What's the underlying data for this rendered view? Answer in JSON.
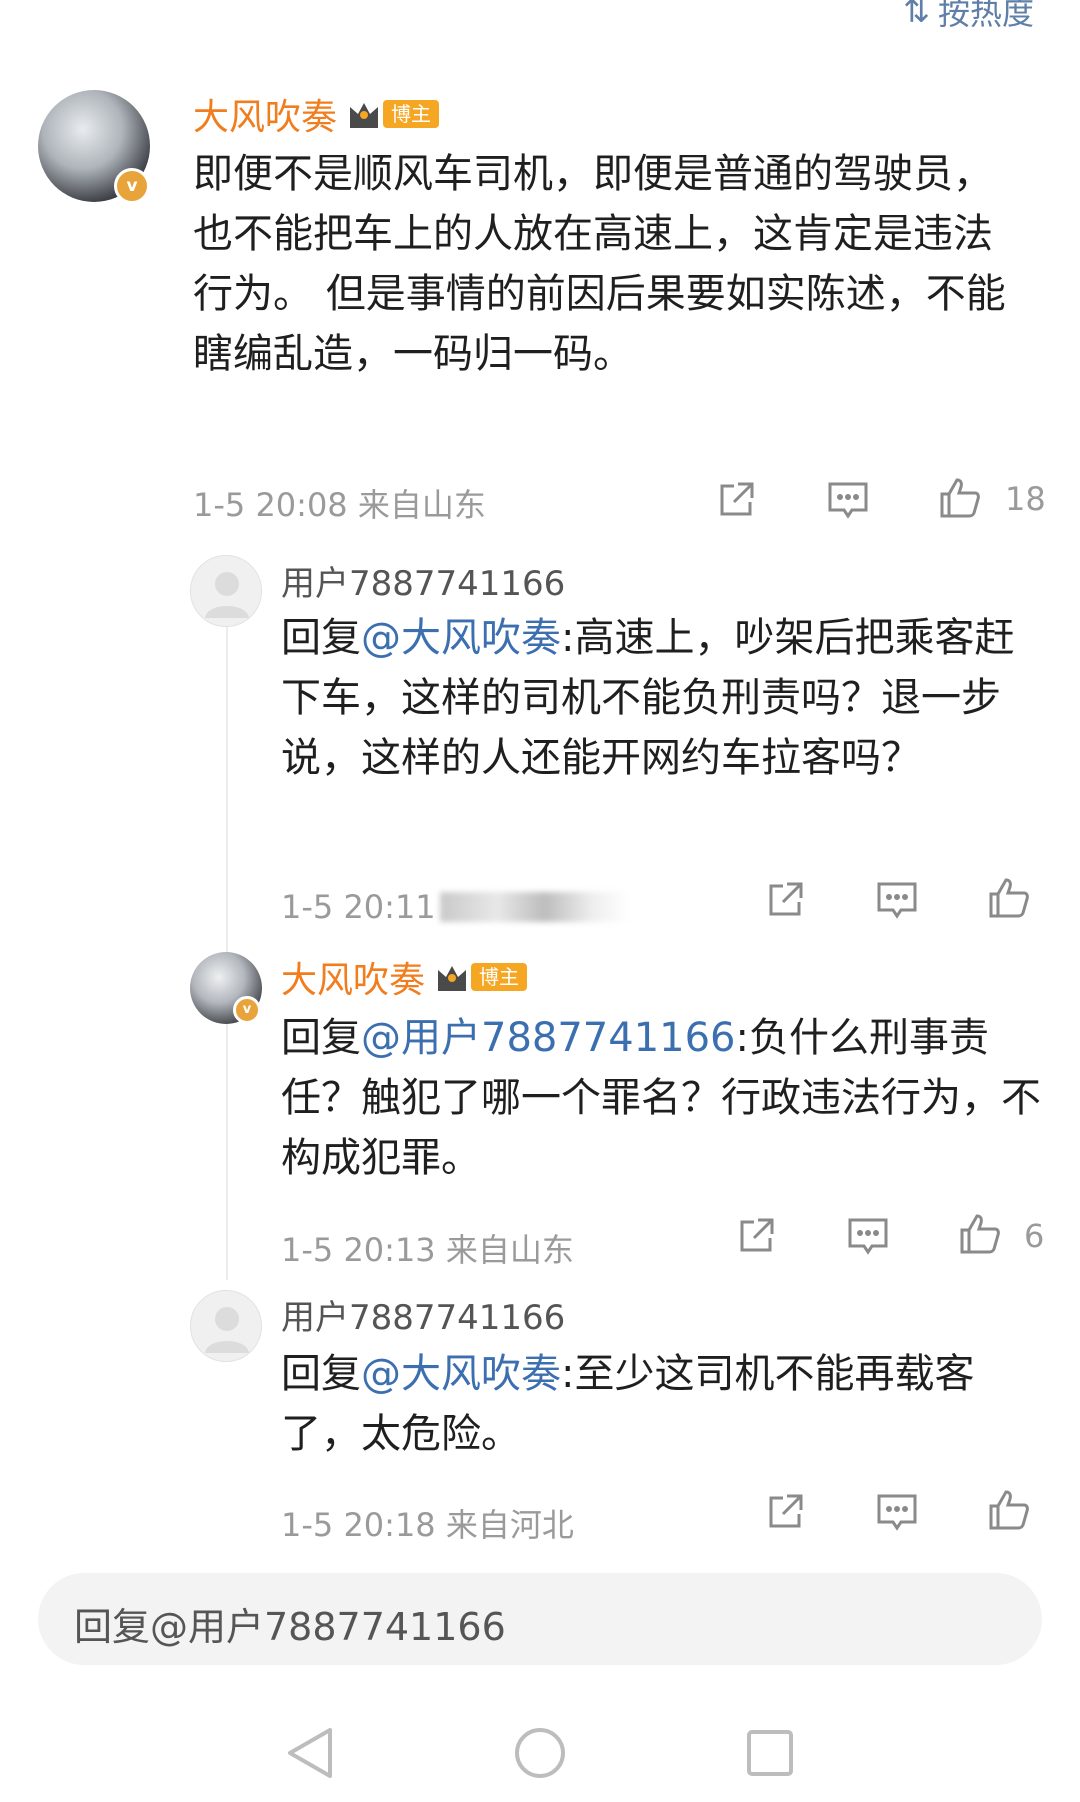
{
  "sort": {
    "label": "按热度"
  },
  "main_comment": {
    "author": "大风吹奏",
    "badge": "博主",
    "text": "即便不是顺风车司机，即便是普通的驾驶员，也不能把车上的人放在高速上，这肯定是违法行为。 但是事情的前因后果要如实陈述，不能瞎编乱造，一码归一码。",
    "time": "1-5 20:08 来自山东",
    "likes": "18"
  },
  "replies": [
    {
      "author": "用户7887741166",
      "prefix": "回复",
      "mention": "@大风吹奏",
      "text": ":高速上，吵架后把乘客赶下车，这样的司机不能负刑责吗？退一步说，这样的人还能开网约车拉客吗？",
      "time": "1-5 20:11",
      "likes": ""
    },
    {
      "author": "大风吹奏",
      "badge": "博主",
      "prefix": "回复",
      "mention": "@用户7887741166",
      "text": ":负什么刑事责任？触犯了哪一个罪名？行政违法行为，不构成犯罪。",
      "time": "1-5 20:13 来自山东",
      "likes": "6"
    },
    {
      "author": "用户7887741166",
      "prefix": "回复",
      "mention": "@大风吹奏",
      "text": ":至少这司机不能再载客了，太危险。",
      "time": "1-5 20:18 来自河北",
      "likes": ""
    }
  ],
  "input": {
    "placeholder": "回复@用户7887741166"
  },
  "colors": {
    "accent_orange": "#f07d1e",
    "mention_blue": "#3c6fb0",
    "meta_gray": "#9a9a9a"
  }
}
